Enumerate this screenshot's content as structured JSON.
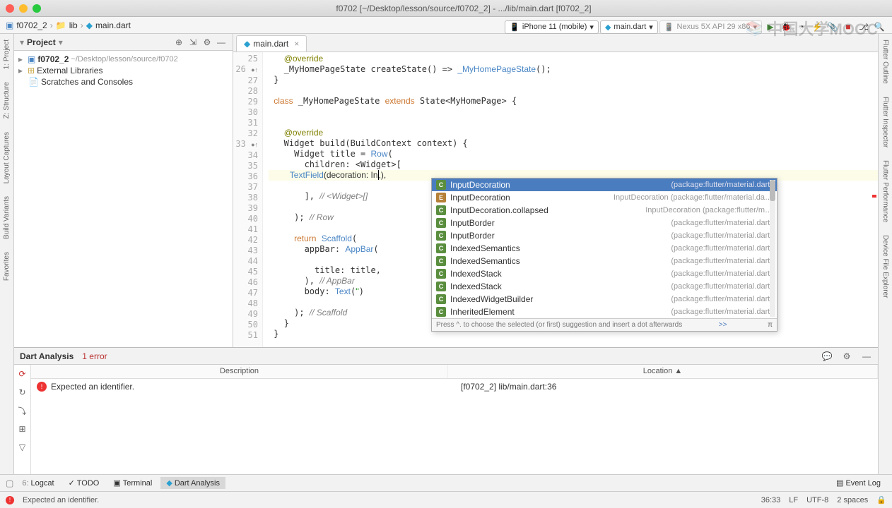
{
  "titlebar": {
    "title": "f0702 [~/Desktop/lesson/source/f0702_2] - .../lib/main.dart [f0702_2]"
  },
  "breadcrumb": {
    "project": "f0702_2",
    "folder": "lib",
    "file": "main.dart"
  },
  "toolbar": {
    "device": "iPhone 11 (mobile)",
    "config": "main.dart",
    "avd": "Nexus 5X API 29 x86"
  },
  "project_panel": {
    "title": "Project",
    "root": "f0702_2",
    "root_path": "~/Desktop/lesson/source/f0702",
    "external": "External Libraries",
    "scratches": "Scratches and Consoles"
  },
  "tabs": {
    "file": "main.dart"
  },
  "code": {
    "lines_start": 25,
    "lines_end": 51,
    "l25": "@override",
    "l26": "_MyHomePageState createState() => _MyHomePageState();",
    "l27": "}",
    "l28": "",
    "l29": "class _MyHomePageState extends State<MyHomePage> {",
    "l30": "",
    "l31": "",
    "l32": "@override",
    "l33": "Widget build(BuildContext context) {",
    "l34": "  Widget title = Row(",
    "l35": "    children: <Widget>[",
    "l36": "      TextField(decoration: In|,),",
    "l37": "",
    "l38": "    ], // <Widget>[]",
    "l39": "",
    "l40": "  ); // Row",
    "l41": "",
    "l42": "  return Scaffold(",
    "l43": "    appBar: AppBar(",
    "l44": "",
    "l45": "      title: title,",
    "l46": "    ), // AppBar",
    "l47": "    body: Text('')",
    "l48": "",
    "l49": "  ); // Scaffold",
    "l50": "}",
    "l51": "}"
  },
  "autocomplete": {
    "items": [
      {
        "kind": "c",
        "name": "InputDecoration",
        "pkg": "(package:flutter/material.dart)"
      },
      {
        "kind": "e",
        "name": "InputDecoration",
        "pkg": "InputDecoration  (package:flutter/material.da…"
      },
      {
        "kind": "c",
        "name": "InputDecoration.collapsed",
        "pkg": "InputDecoration  (package:flutter/m…"
      },
      {
        "kind": "c",
        "name": "InputBorder",
        "pkg": "(package:flutter/material.dart)"
      },
      {
        "kind": "c",
        "name": "InputBorder",
        "pkg": "(package:flutter/material.dart)"
      },
      {
        "kind": "c",
        "name": "IndexedSemantics",
        "pkg": "(package:flutter/material.dart)"
      },
      {
        "kind": "c",
        "name": "IndexedSemantics",
        "pkg": "(package:flutter/material.dart)"
      },
      {
        "kind": "c",
        "name": "IndexedStack",
        "pkg": "(package:flutter/material.dart)"
      },
      {
        "kind": "c",
        "name": "IndexedStack",
        "pkg": "(package:flutter/material.dart)"
      },
      {
        "kind": "c",
        "name": "IndexedWidgetBuilder",
        "pkg": "(package:flutter/material.dart)"
      },
      {
        "kind": "c",
        "name": "InheritedElement",
        "pkg": "(package:flutter/material.dart)"
      }
    ],
    "footer": "Press ^. to choose the selected (or first) suggestion and insert a dot afterwards",
    "footer_link": ">>"
  },
  "analysis": {
    "title": "Dart Analysis",
    "count": "1 error",
    "col_desc": "Description",
    "col_loc": "Location ▲",
    "row_desc": "Expected an identifier.",
    "row_loc": "[f0702_2] lib/main.dart:36"
  },
  "bottom": {
    "logcat": "Logcat",
    "logcat_num": "6:",
    "todo": "TODO",
    "terminal": "Terminal",
    "dart": "Dart Analysis",
    "eventlog": "Event Log"
  },
  "status": {
    "msg": "Expected an identifier.",
    "pos": "36:33",
    "le": "LF",
    "enc": "UTF-8",
    "spaces": "2 spaces"
  },
  "right_labels": {
    "outline": "Flutter Outline",
    "inspector": "Flutter Inspector",
    "perf": "Flutter Performance",
    "device": "Device File Explorer"
  },
  "left_labels": {
    "project": "1: Project",
    "layout": "Z: Structure",
    "variants": "Build Variants",
    "captures": "Layout Captures",
    "favorites": "Favorites"
  },
  "watermark": "中国大学MOOC"
}
